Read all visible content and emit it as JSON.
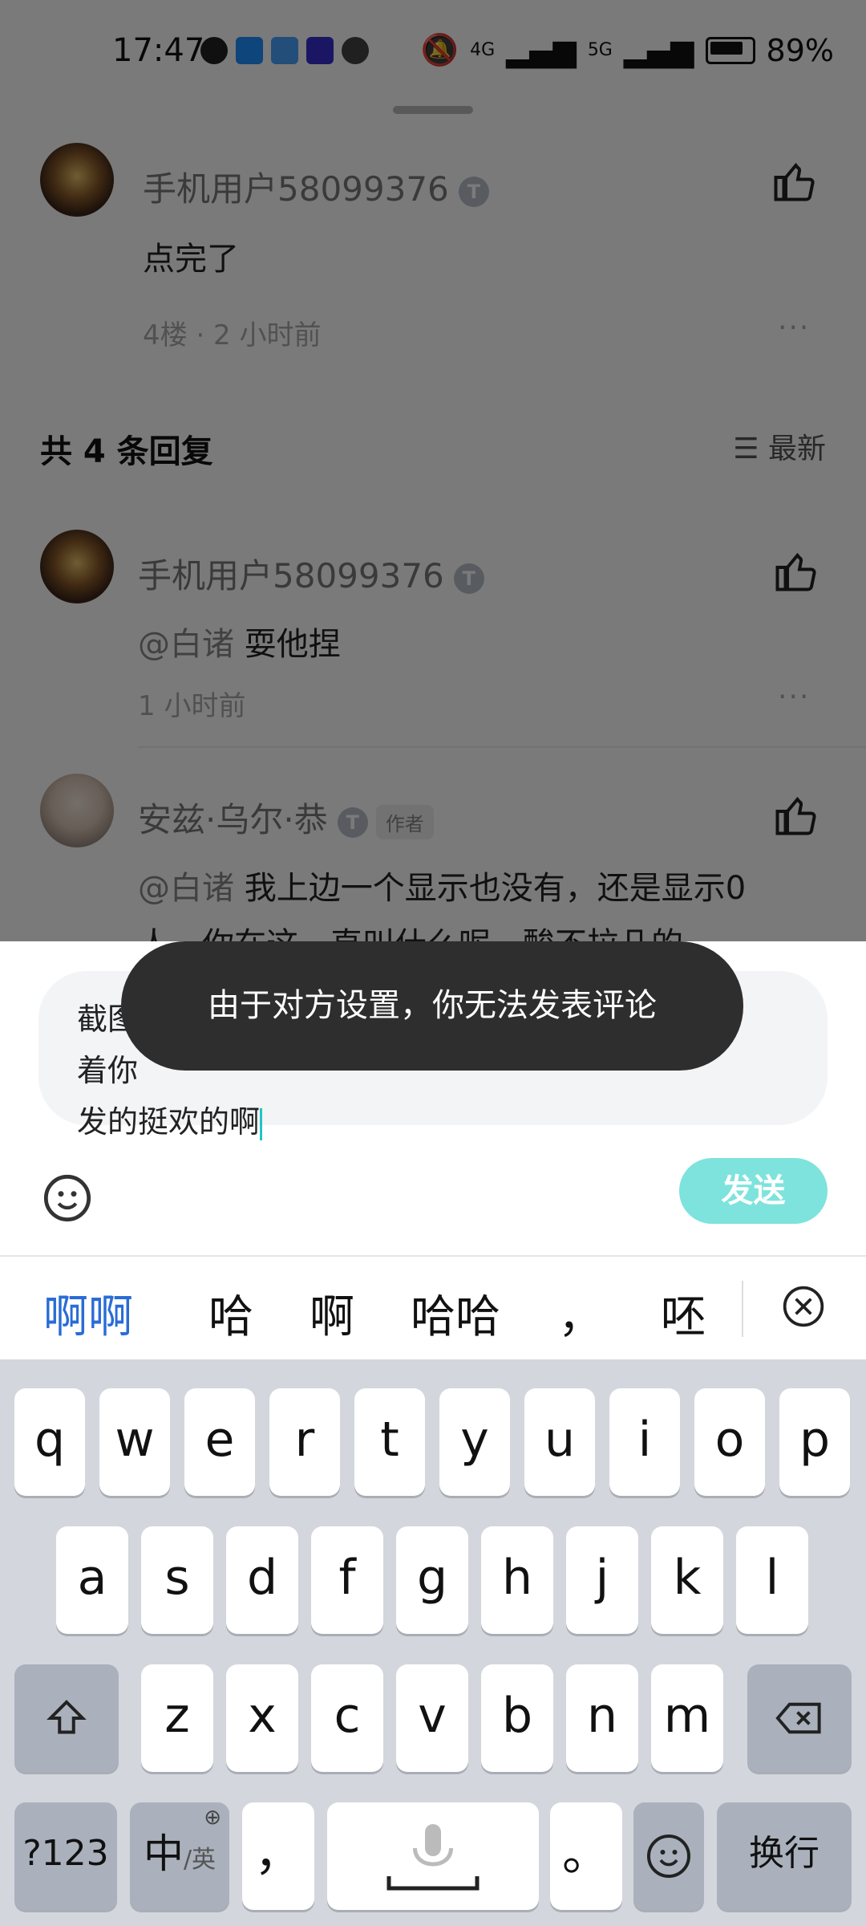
{
  "status_bar": {
    "time": "17:47",
    "battery": "89%",
    "network_1": "4G",
    "network_2": "5G"
  },
  "comment": {
    "username": "手机用户58099376",
    "level": "T",
    "text": "点完了",
    "meta": "4楼 · 2 小时前",
    "more": "···"
  },
  "replies_header": {
    "title": "共 4 条回复",
    "sort_label": "最新"
  },
  "replies": [
    {
      "username": "手机用户58099376",
      "level": "T",
      "mention": "@白诸",
      "text": "耍他捏",
      "meta": "1 小时前",
      "more": "···"
    },
    {
      "username": "安兹·乌尔·恭",
      "level": "T",
      "author_tag": "作者",
      "mention": "@白诸",
      "text_line1": "我上边一个显示也没有，还是显示0",
      "text_line2": "人，你在这一直叫什么呢，酸不拉几的"
    }
  ],
  "input": {
    "line1_left": "截图",
    "line1_right": "着你",
    "line2": "发的挺欢的啊"
  },
  "send_button": "发送",
  "toast": "由于对方设置，你无法发表评论",
  "candidates": [
    "啊啊",
    "哈",
    "啊",
    "哈哈",
    "，",
    "呸"
  ],
  "keyboard": {
    "row1": [
      "q",
      "w",
      "e",
      "r",
      "t",
      "y",
      "u",
      "i",
      "o",
      "p"
    ],
    "row2": [
      "a",
      "s",
      "d",
      "f",
      "g",
      "h",
      "j",
      "k",
      "l"
    ],
    "row3": [
      "z",
      "x",
      "c",
      "v",
      "b",
      "n",
      "m"
    ],
    "num_key": "?123",
    "lang_main": "中",
    "lang_sub": "/英",
    "comma": "，",
    "period": "。",
    "enter": "换行"
  },
  "colors": {
    "accent": "#1fc7c0",
    "send_bg": "#7ee3dc",
    "candidate_active": "#2a6cd6",
    "toast_bg": "#2e2e2e"
  }
}
